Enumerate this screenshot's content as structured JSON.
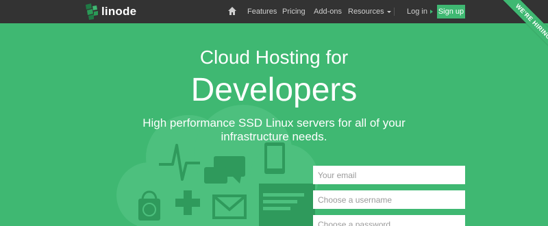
{
  "brand": {
    "name": "linode",
    "accent": "#3fb872",
    "nav_bg": "#333333"
  },
  "nav": {
    "home_icon": "home-icon",
    "items": [
      {
        "label": "Features"
      },
      {
        "label": "Pricing"
      },
      {
        "label": "Add-ons"
      },
      {
        "label": "Resources"
      }
    ],
    "login": "Log in",
    "signup": "Sign up"
  },
  "ribbon": {
    "text": "WE'RE HIRING!"
  },
  "hero": {
    "title_line1": "Cloud Hosting for",
    "title_line2": "Developers",
    "subtitle": "High performance SSD Linux servers for all of your infrastructure needs."
  },
  "form": {
    "email_placeholder": "Your email",
    "username_placeholder": "Choose a username",
    "password_placeholder": "Choose a password"
  },
  "illustration_icons": [
    "cloud-icon",
    "heartbeat-icon",
    "chat-icon",
    "tablet-icon",
    "shopping-bag-icon",
    "gamepad-icon",
    "mail-icon",
    "browser-window-icon"
  ]
}
